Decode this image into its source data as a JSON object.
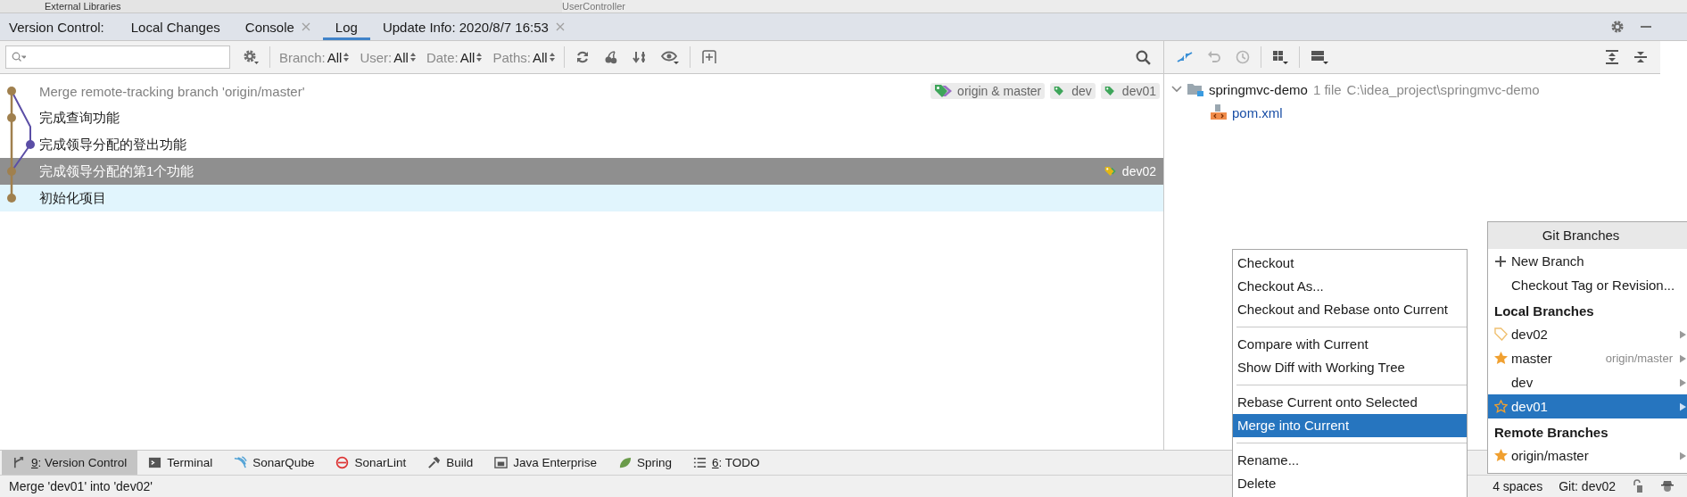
{
  "editor_strip": {
    "project_item": "External Libraries",
    "editor_tab": "UserController"
  },
  "tool_window": {
    "title": "Version Control:",
    "tabs": [
      {
        "label": "Local Changes",
        "closable": false,
        "selected": false
      },
      {
        "label": "Console",
        "closable": true,
        "selected": false
      },
      {
        "label": "Log",
        "closable": false,
        "selected": true
      },
      {
        "label": "Update Info: 2020/8/7 16:53",
        "closable": true,
        "selected": false
      }
    ]
  },
  "log_toolbar": {
    "filters": [
      {
        "label": "Branch:",
        "value": "All"
      },
      {
        "label": "User:",
        "value": "All"
      },
      {
        "label": "Date:",
        "value": "All"
      },
      {
        "label": "Paths:",
        "value": "All"
      }
    ]
  },
  "commits": [
    {
      "subject": "Merge remote-tracking branch 'origin/master'",
      "dimmed": true,
      "selected": false,
      "highlighted": false,
      "refs": [
        {
          "label": "origin & master",
          "kind": "local-remote"
        },
        {
          "label": "dev",
          "kind": "local"
        },
        {
          "label": "dev01",
          "kind": "local"
        }
      ]
    },
    {
      "subject": "完成查询功能",
      "dimmed": false,
      "selected": false,
      "highlighted": false
    },
    {
      "subject": "完成领导分配的登出功能",
      "dimmed": false,
      "selected": false,
      "highlighted": false
    },
    {
      "subject": "完成领导分配的第1个功能",
      "dimmed": false,
      "selected": true,
      "highlighted": false,
      "refs": [
        {
          "label": "dev02",
          "kind": "head"
        }
      ]
    },
    {
      "subject": "初始化项目",
      "dimmed": false,
      "selected": false,
      "highlighted": true
    }
  ],
  "changes_tree": {
    "root": {
      "name": "springmvc-demo",
      "expanded": true,
      "count": "1 file",
      "path": "C:\\idea_project\\springmvc-demo",
      "children": [
        {
          "name": "pom.xml"
        }
      ]
    }
  },
  "context_menu": {
    "groups": [
      [
        {
          "label": "Checkout",
          "selected": false
        },
        {
          "label": "Checkout As...",
          "selected": false
        },
        {
          "label": "Checkout and Rebase onto Current",
          "selected": false
        }
      ],
      [
        {
          "label": "Compare with Current",
          "selected": false
        },
        {
          "label": "Show Diff with Working Tree",
          "selected": false
        }
      ],
      [
        {
          "label": "Rebase Current onto Selected",
          "selected": false
        },
        {
          "label": "Merge into Current",
          "selected": true
        }
      ],
      [
        {
          "label": "Rename...",
          "selected": false
        },
        {
          "label": "Delete",
          "selected": false
        }
      ]
    ]
  },
  "branches_popup": {
    "title": "Git Branches",
    "actions": [
      {
        "label": "New Branch",
        "kind": "new"
      },
      {
        "label": "Checkout Tag or Revision...",
        "kind": "plain"
      }
    ],
    "sections": [
      {
        "title": "Local Branches",
        "branches": [
          {
            "name": "dev02",
            "kind": "current",
            "selected": false
          },
          {
            "name": "master",
            "kind": "favorite",
            "tracking": "origin/master",
            "selected": false
          },
          {
            "name": "dev",
            "kind": "plain",
            "selected": false
          },
          {
            "name": "dev01",
            "kind": "plain",
            "selected": true
          }
        ]
      },
      {
        "title": "Remote Branches",
        "branches": [
          {
            "name": "origin/master",
            "kind": "favorite",
            "selected": false
          }
        ]
      }
    ]
  },
  "tool_bar": [
    {
      "mnemonic": "9",
      "label": ": Version Control",
      "selected": true
    },
    {
      "label": "Terminal",
      "selected": false
    },
    {
      "label": "SonarQube",
      "selected": false
    },
    {
      "label": "SonarLint",
      "selected": false
    },
    {
      "label": "Build",
      "selected": false
    },
    {
      "label": "Java Enterprise",
      "selected": false
    },
    {
      "label": "Spring",
      "selected": false
    },
    {
      "mnemonic": "6",
      "label": ": TODO",
      "selected": false
    }
  ],
  "status_bar": {
    "message": "Merge 'dev01' into 'dev02'",
    "indent": "4 spaces",
    "git_branch": "Git: dev02"
  }
}
